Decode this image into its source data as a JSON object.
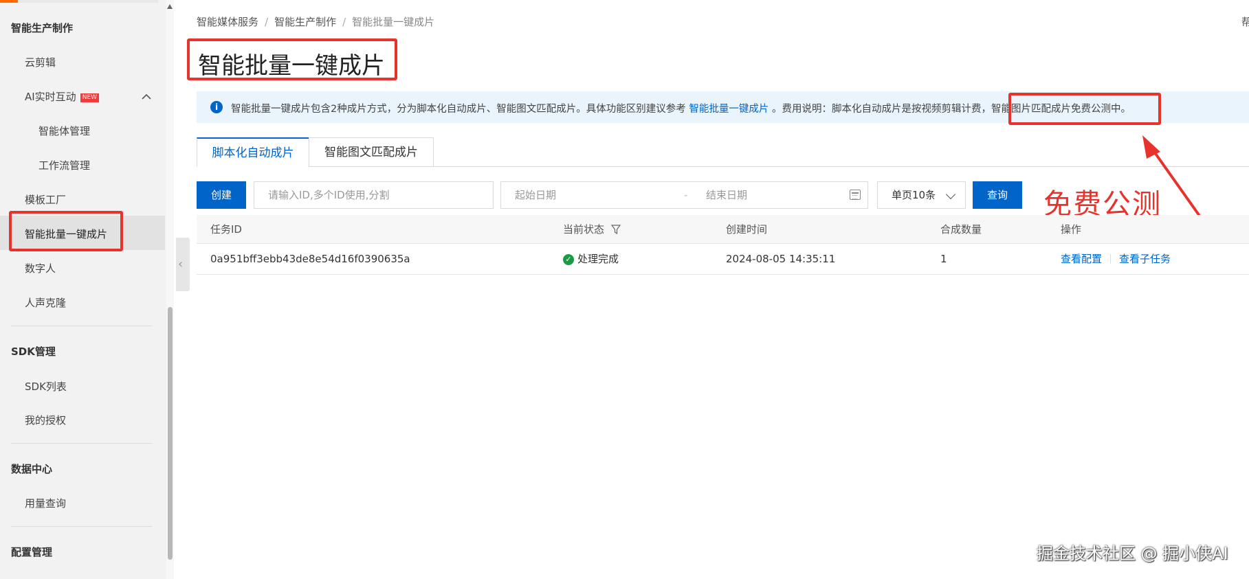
{
  "sidebar": {
    "groups": {
      "production": "智能生产制作",
      "sdk": "SDK管理",
      "data": "数据中心",
      "config": "配置管理"
    },
    "items": {
      "cloud_edit": "云剪辑",
      "ai_interact": "AI实时互动",
      "ai_interact_badge": "NEW",
      "agent_mgmt": "智能体管理",
      "workflow_mgmt": "工作流管理",
      "template_factory": "模板工厂",
      "batch_one_click": "智能批量一键成片",
      "digital_human": "数字人",
      "voice_clone": "人声克隆",
      "sdk_list": "SDK列表",
      "my_auth": "我的授权",
      "usage_query": "用量查询"
    }
  },
  "breadcrumb": [
    "智能媒体服务",
    "智能生产制作",
    "智能批量一键成片"
  ],
  "help_partial": "帮",
  "page_title": "智能批量一键成片",
  "notice": {
    "text_before": "智能批量一键成片包含2种成片方式，分为脚本化自动成片、智能图文匹配成片。具体功能区别建议参考",
    "link": "智能批量一键成片",
    "text_middle": "。费用说明：脚本化自动成片是按视频剪辑计费，",
    "text_highlight": "智能图片匹配成片免费公测中。"
  },
  "tabs": [
    "脚本化自动成片",
    "智能图文匹配成片"
  ],
  "toolbar": {
    "create": "创建",
    "id_placeholder": "请输入ID,多个ID使用,分割",
    "start_date": "起始日期",
    "date_sep": "-",
    "end_date": "结束日期",
    "page_size": "单页10条",
    "query": "查询"
  },
  "annotation": "免费公测",
  "table": {
    "headers": {
      "task_id": "任务ID",
      "status": "当前状态",
      "created": "创建时间",
      "count": "合成数量",
      "actions": "操作"
    },
    "rows": [
      {
        "task_id": "0a951bff3ebb43de8e54d16f0390635a",
        "status": "处理完成",
        "created": "2024-08-05 14:35:11",
        "count": "1",
        "action_view_config": "查看配置",
        "action_view_subtasks": "查看子任务"
      }
    ]
  },
  "watermark": "掘金技术社区 @ 掘小侠AI",
  "colors": {
    "accent": "#0064c8",
    "annotation_red": "#e8332d",
    "success_green": "#1a9b43",
    "brand_orange": "#ff6a00"
  }
}
